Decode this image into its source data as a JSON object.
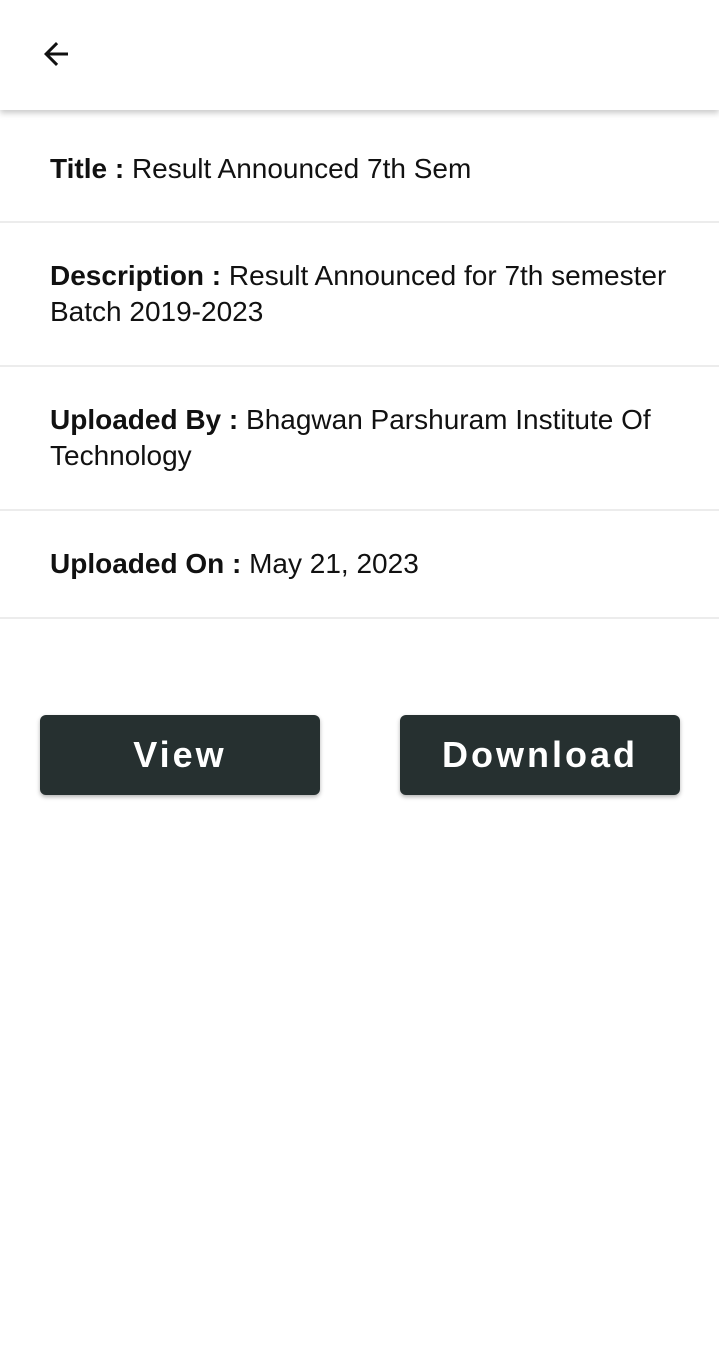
{
  "app_bar": {
    "back_icon": "arrow-left-icon"
  },
  "details": {
    "title": {
      "label": "Title :",
      "value": "Result Announced 7th Sem"
    },
    "description": {
      "label": "Description :",
      "value": "Result Announced for 7th semester Batch 2019-2023"
    },
    "uploaded_by": {
      "label": "Uploaded By :",
      "value": "Bhagwan Parshuram Institute Of Technology"
    },
    "uploaded_on": {
      "label": "Uploaded On :",
      "value": "May 21, 2023"
    }
  },
  "actions": {
    "view_label": "View",
    "download_label": "Download"
  },
  "colors": {
    "button_background": "#263030",
    "button_text": "#ffffff",
    "divider": "#ececec"
  }
}
